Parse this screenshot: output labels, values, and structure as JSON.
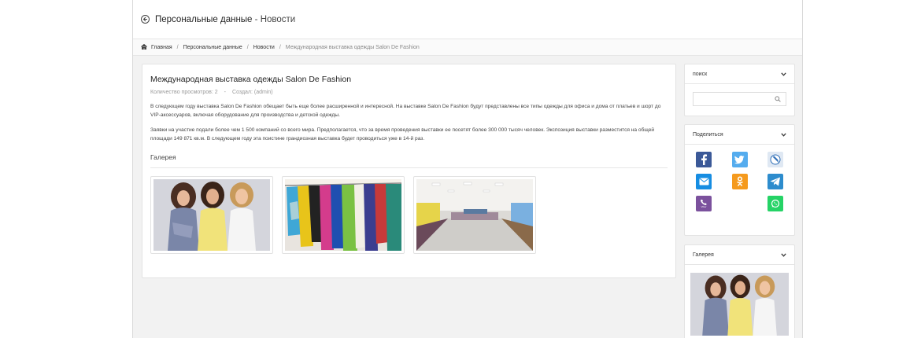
{
  "header": {
    "title_main": "Персональные данные",
    "title_sep": " - ",
    "title_sub": "Новости"
  },
  "breadcrumb": {
    "items": [
      "Главная",
      "Персональные данные",
      "Новости",
      "Международная выставка одежды Salon De Fashion"
    ],
    "separator": "/"
  },
  "article": {
    "title": "Международная выставка одежды Salon De Fashion",
    "views": "Количество просмотров: 2",
    "meta_sep": "-",
    "author": "Создал: (admin)",
    "paragraphs": [
      "В следующем  году выставка Salon De Fashion обещает быть еще более расширенной и интересной. На выставке Salon De Fashion будут представлены все типы одежды для офиса и дома от платьев и шорт до VIP-аксессуаров, включая оборудование для производства и детской одежды.",
      "Заявки на участие подали более чем 1 500 компаний со всего мира. Предполагается, что за время проведения выставки ее посетят более 300 000 тысяч человек. Экспозиция выставки разместится на общей площади 149 871 кв.м. В следующем году эта поистине грандиозная выставка будет проводиться уже в 14-й раз."
    ],
    "gallery_heading": "Галерея"
  },
  "sidebar": {
    "search": {
      "title": "поиск",
      "value": "",
      "placeholder": ""
    },
    "share": {
      "title": "Поделиться",
      "icons": [
        "facebook-icon",
        "twitter-icon",
        "livejournal-icon",
        "mail-icon",
        "odnoklassniki-icon",
        "telegram-icon",
        "viber-icon",
        "whatsapp-icon"
      ],
      "viber_label": "Viber"
    },
    "gallery": {
      "title": "Галерея"
    }
  },
  "colors": {
    "facebook": "#3b5998",
    "twitter": "#55acee",
    "livejournal": "#2f6fb7",
    "mail": "#168de2",
    "odnoklassniki": "#f59a1d",
    "telegram": "#2d8ccd",
    "viber": "#7b519d",
    "whatsapp": "#25d366"
  }
}
